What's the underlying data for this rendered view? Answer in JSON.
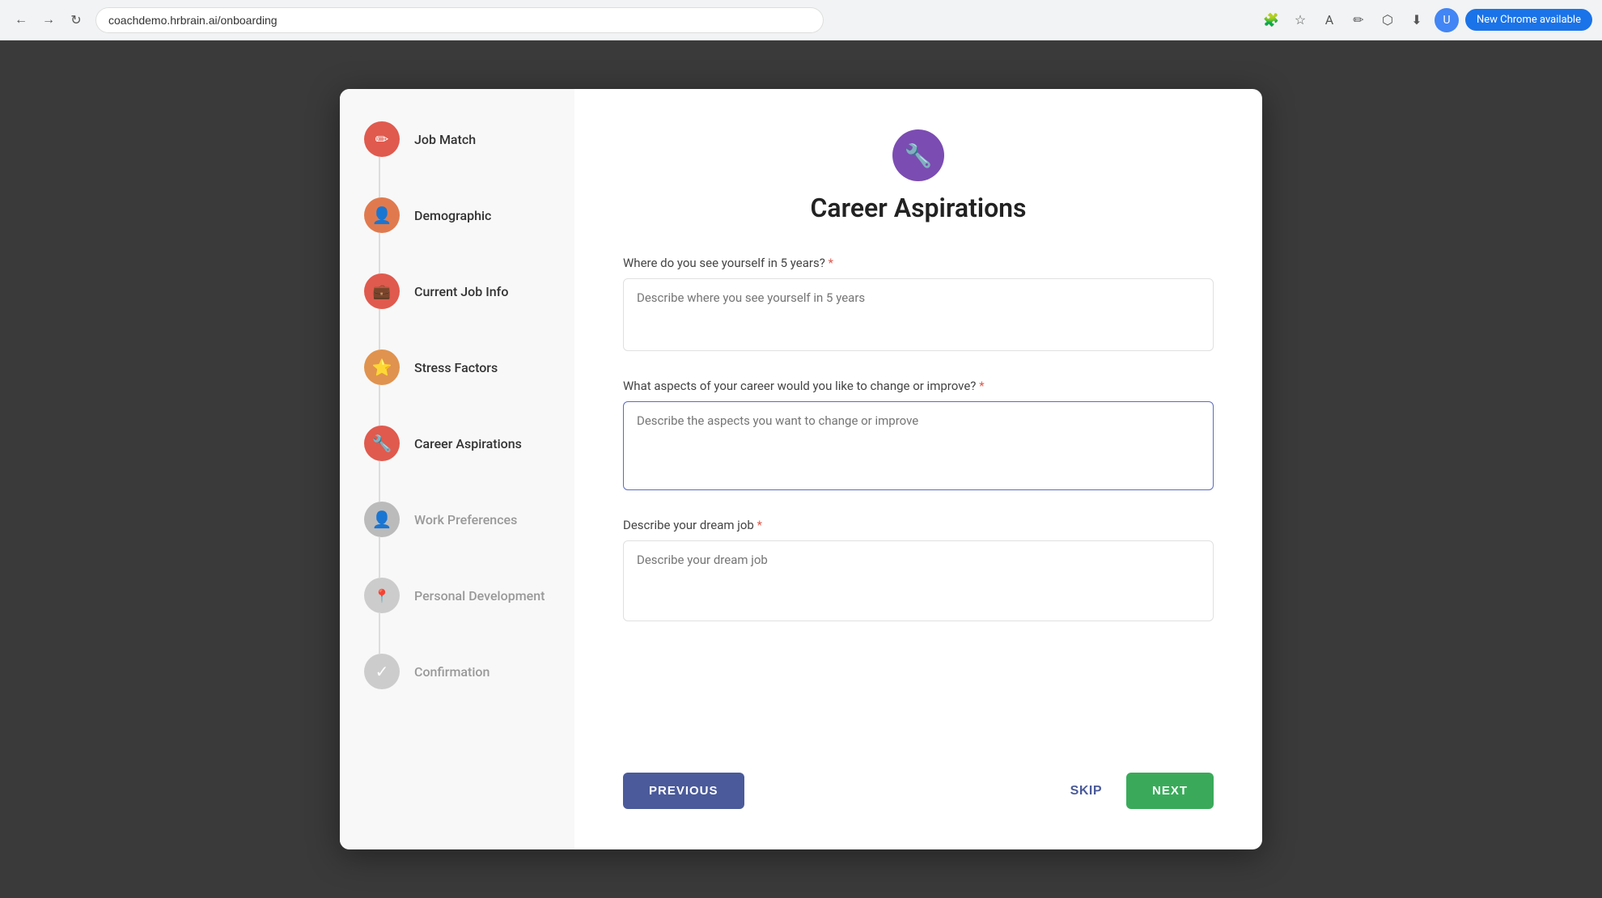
{
  "browser": {
    "url": "coachdemo.hrbrain.ai/onboarding",
    "new_chrome_label": "New Chrome available"
  },
  "sidebar": {
    "items": [
      {
        "id": "job-match",
        "label": "Job Match",
        "icon": "✏️",
        "icon_type": "red",
        "active": false,
        "inactive": false
      },
      {
        "id": "demographic",
        "label": "Demographic",
        "icon": "👤",
        "icon_type": "orange",
        "active": false,
        "inactive": false
      },
      {
        "id": "current-job-info",
        "label": "Current Job Info",
        "icon": "💼",
        "icon_type": "briefcase",
        "active": false,
        "inactive": false
      },
      {
        "id": "stress-factors",
        "label": "Stress Factors",
        "icon": "⭐",
        "icon_type": "star",
        "active": false,
        "inactive": false
      },
      {
        "id": "career-aspirations",
        "label": "Career Aspirations",
        "icon": "🔧",
        "icon_type": "active",
        "active": true,
        "inactive": false
      },
      {
        "id": "work-preferences",
        "label": "Work Preferences",
        "icon": "👤",
        "icon_type": "gray",
        "active": false,
        "inactive": true
      },
      {
        "id": "personal-development",
        "label": "Personal Development",
        "icon": "📍",
        "icon_type": "light-gray",
        "active": false,
        "inactive": true
      },
      {
        "id": "confirmation",
        "label": "Confirmation",
        "icon": "✓",
        "icon_type": "light-gray",
        "active": false,
        "inactive": true
      }
    ]
  },
  "main": {
    "page_icon": "🔧",
    "page_title": "Career Aspirations",
    "form": {
      "fields": [
        {
          "id": "five-years",
          "label": "Where do you see yourself in 5 years?",
          "required": true,
          "placeholder": "Describe where you see yourself in 5 years",
          "height": "short"
        },
        {
          "id": "career-change",
          "label": "What aspects of your career would you like to change or improve?",
          "required": true,
          "placeholder": "Describe the aspects you want to change or improve",
          "height": "medium"
        },
        {
          "id": "dream-job",
          "label": "Describe your dream job",
          "required": true,
          "placeholder": "Describe your dream job",
          "height": "tall"
        }
      ]
    },
    "buttons": {
      "previous": "PREVIOUS",
      "skip": "SKIP",
      "next": "NEXT"
    }
  }
}
